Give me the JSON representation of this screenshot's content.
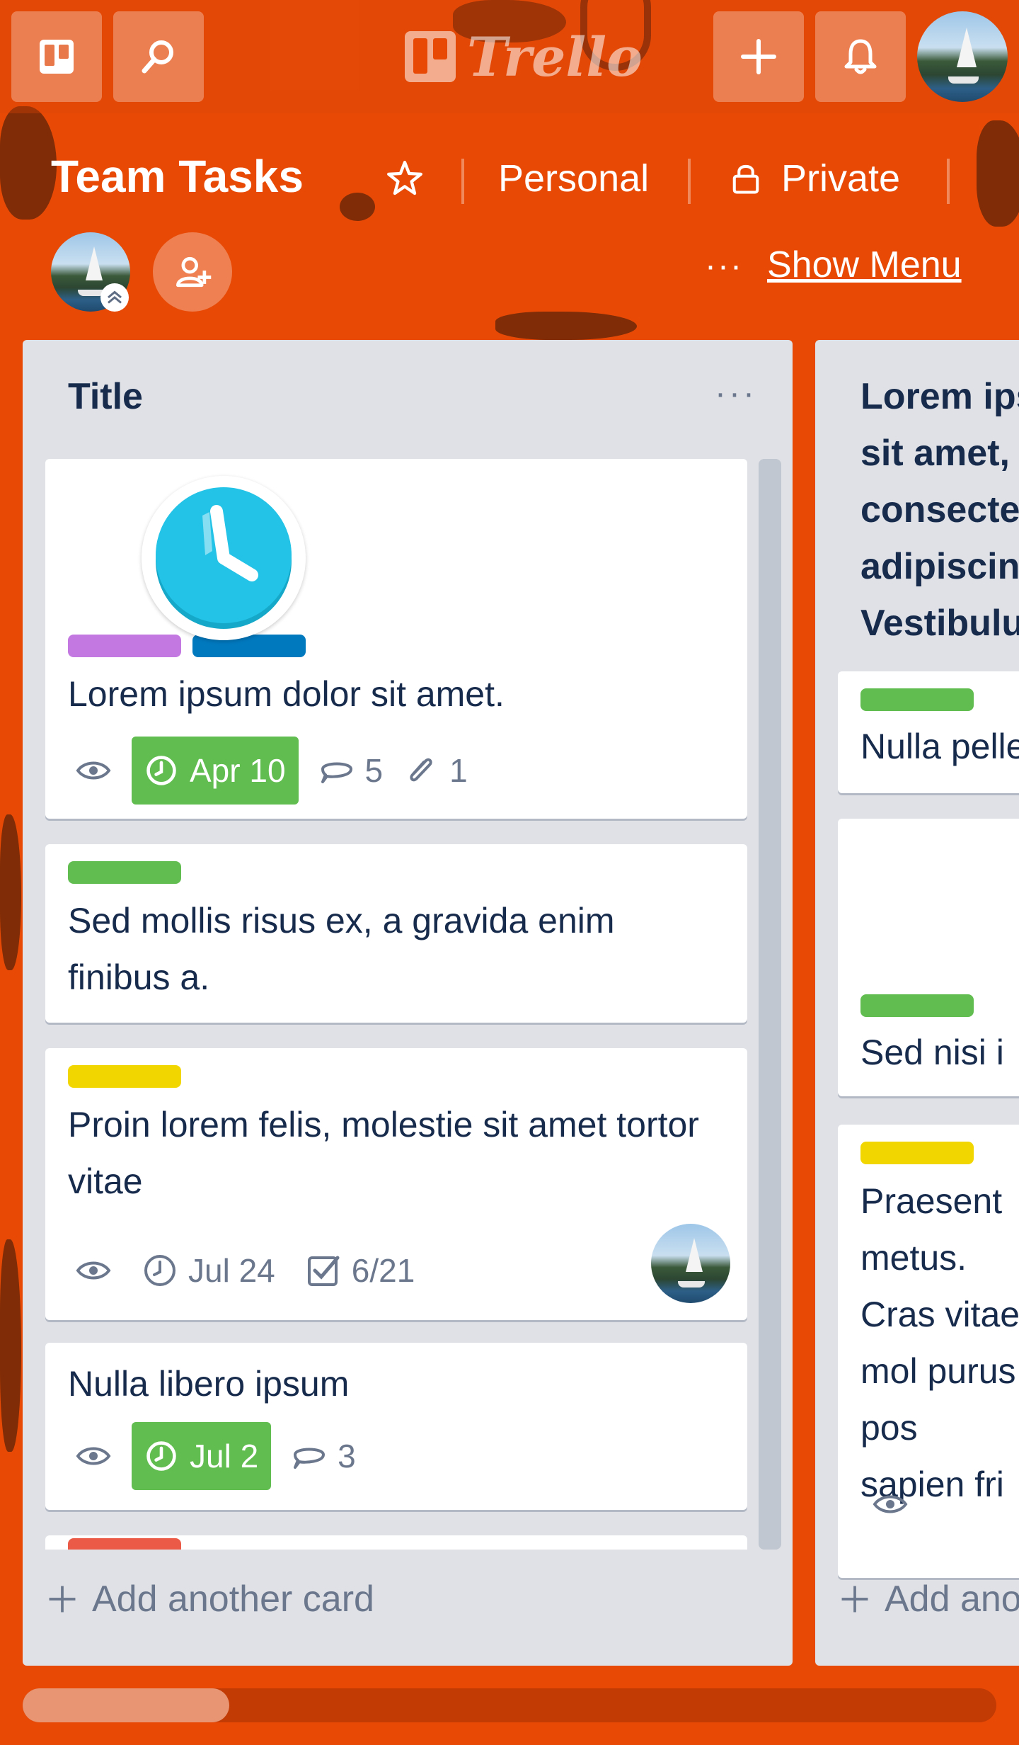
{
  "app": {
    "logo_text": "Trello"
  },
  "colors": {
    "background": "#E84A06",
    "list_bg": "#DFE1E6",
    "label_purple": "#C377E0",
    "label_blue": "#0079BF",
    "label_green": "#61BD4F",
    "label_yellow": "#F2D600",
    "label_red": "#EB5A46",
    "due_green": "#61BD4F"
  },
  "topbar": {
    "boards_icon": "boards-icon",
    "search_icon": "search-icon",
    "add_icon": "plus-icon",
    "notifications_icon": "bell-icon"
  },
  "board": {
    "title": "Team Tasks",
    "team": "Personal",
    "visibility": "Private",
    "menu_dots": "···",
    "show_menu": "Show Menu"
  },
  "lists": [
    {
      "title": "Title",
      "menu_dots": "···",
      "add_card": "Add another card",
      "cards": [
        {
          "cover": "clock-icon",
          "labels": [
            "purple",
            "blue"
          ],
          "text": "Lorem ipsum dolor sit amet.",
          "due": "Apr 10",
          "comments": "5",
          "attachments": "1"
        },
        {
          "labels": [
            "green"
          ],
          "text": "Sed mollis risus ex, a gravida enim finibus a."
        },
        {
          "labels": [
            "yellow"
          ],
          "text": "Proin lorem felis, molestie sit amet tortor vitae",
          "due": "Jul 24",
          "checklist": "6/21"
        },
        {
          "labels": [],
          "text": "Nulla libero ipsum",
          "due": "Jul 2",
          "comments": "3"
        }
      ]
    },
    {
      "title": "Lorem ipsum dolor sit amet, consectetur adipiscing elit. Vestibulum magna co",
      "add_card": "Add another card",
      "cards": [
        {
          "labels": [
            "green"
          ],
          "text": "Nulla pellentesque"
        },
        {
          "labels": [
            "green"
          ],
          "text": "Sed nisi i"
        },
        {
          "labels": [
            "yellow"
          ],
          "text": "Praesent metus. Cras vitae mol purus pos sapien fri"
        }
      ]
    }
  ]
}
